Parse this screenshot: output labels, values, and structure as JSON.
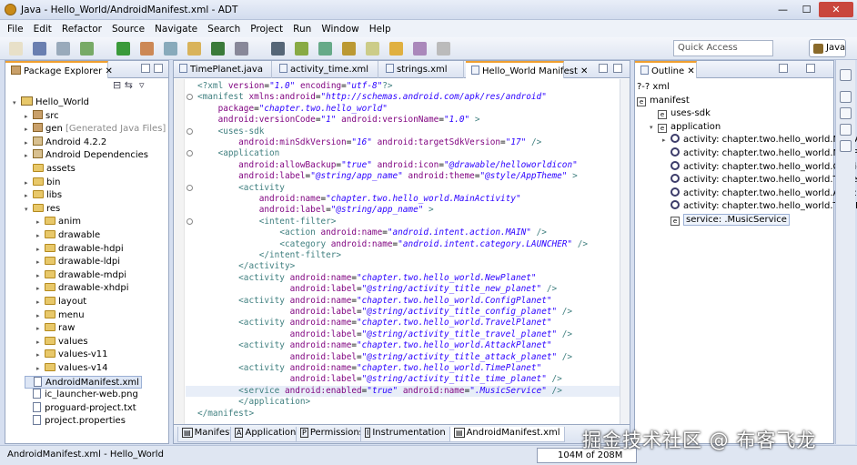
{
  "window": {
    "title": "Java - Hello_World/AndroidManifest.xml - ADT",
    "min": "—",
    "max": "☐",
    "close": "✕"
  },
  "menu": [
    "File",
    "Edit",
    "Refactor",
    "Source",
    "Navigate",
    "Search",
    "Project",
    "Run",
    "Window",
    "Help"
  ],
  "toolbar": {
    "quick_access_placeholder": "Quick Access",
    "perspective": "Java"
  },
  "package_explorer": {
    "title": "Package Explorer",
    "items": [
      {
        "label": "Hello_World",
        "extra": "",
        "icon": "project-icon",
        "depth": 0,
        "twisty": "▾"
      },
      {
        "label": "src",
        "extra": "",
        "icon": "package-folder-icon",
        "depth": 1,
        "twisty": "▸"
      },
      {
        "label": "gen",
        "extra": "[Generated Java Files]",
        "icon": "package-folder-icon",
        "depth": 1,
        "twisty": "▸"
      },
      {
        "label": "Android 4.2.2",
        "extra": "",
        "icon": "library-icon",
        "depth": 1,
        "twisty": "▸"
      },
      {
        "label": "Android Dependencies",
        "extra": "",
        "icon": "library-icon",
        "depth": 1,
        "twisty": "▸"
      },
      {
        "label": "assets",
        "extra": "",
        "icon": "folder-icon",
        "depth": 1,
        "twisty": ""
      },
      {
        "label": "bin",
        "extra": "",
        "icon": "folder-icon",
        "depth": 1,
        "twisty": "▸"
      },
      {
        "label": "libs",
        "extra": "",
        "icon": "folder-icon",
        "depth": 1,
        "twisty": "▸"
      },
      {
        "label": "res",
        "extra": "",
        "icon": "folder-icon",
        "depth": 1,
        "twisty": "▾"
      },
      {
        "label": "anim",
        "extra": "",
        "icon": "folder-icon",
        "depth": 2,
        "twisty": "▸"
      },
      {
        "label": "drawable",
        "extra": "",
        "icon": "folder-icon",
        "depth": 2,
        "twisty": "▸"
      },
      {
        "label": "drawable-hdpi",
        "extra": "",
        "icon": "folder-icon",
        "depth": 2,
        "twisty": "▸"
      },
      {
        "label": "drawable-ldpi",
        "extra": "",
        "icon": "folder-icon",
        "depth": 2,
        "twisty": "▸"
      },
      {
        "label": "drawable-mdpi",
        "extra": "",
        "icon": "folder-icon",
        "depth": 2,
        "twisty": "▸"
      },
      {
        "label": "drawable-xhdpi",
        "extra": "",
        "icon": "folder-icon",
        "depth": 2,
        "twisty": "▸"
      },
      {
        "label": "layout",
        "extra": "",
        "icon": "folder-icon",
        "depth": 2,
        "twisty": "▸"
      },
      {
        "label": "menu",
        "extra": "",
        "icon": "folder-icon",
        "depth": 2,
        "twisty": "▸"
      },
      {
        "label": "raw",
        "extra": "",
        "icon": "folder-icon",
        "depth": 2,
        "twisty": "▸"
      },
      {
        "label": "values",
        "extra": "",
        "icon": "folder-icon",
        "depth": 2,
        "twisty": "▸"
      },
      {
        "label": "values-v11",
        "extra": "",
        "icon": "folder-icon",
        "depth": 2,
        "twisty": "▸"
      },
      {
        "label": "values-v14",
        "extra": "",
        "icon": "folder-icon",
        "depth": 2,
        "twisty": "▸"
      },
      {
        "label": "AndroidManifest.xml",
        "extra": "",
        "icon": "file-icon",
        "depth": 1,
        "twisty": "",
        "selected": true
      },
      {
        "label": "ic_launcher-web.png",
        "extra": "",
        "icon": "file-icon",
        "depth": 1,
        "twisty": ""
      },
      {
        "label": "proguard-project.txt",
        "extra": "",
        "icon": "file-icon",
        "depth": 1,
        "twisty": ""
      },
      {
        "label": "project.properties",
        "extra": "",
        "icon": "file-icon",
        "depth": 1,
        "twisty": ""
      }
    ]
  },
  "editor": {
    "tabs": [
      "TimePlanet.java",
      "activity_time.xml",
      "strings.xml",
      "Hello_World Manifest"
    ],
    "active_tab": "Hello_World Manifest",
    "bottom_tabs": [
      {
        "badge": "",
        "label": "Manifest"
      },
      {
        "badge": "A",
        "label": "Application"
      },
      {
        "badge": "P",
        "label": "Permissions"
      },
      {
        "badge": "I",
        "label": "Instrumentation"
      },
      {
        "badge": "",
        "label": "AndroidManifest.xml"
      }
    ],
    "lines": [
      "<?xml version=\"1.0\" encoding=\"utf-8\"?>",
      "<manifest xmlns:android=\"http://schemas.android.com/apk/res/android\"",
      "    package=\"chapter.two.hello_world\"",
      "    android:versionCode=\"1\" android:versionName=\"1.0\" >",
      "    <uses-sdk",
      "        android:minSdkVersion=\"16\" android:targetSdkVersion=\"17\" />",
      "    <application",
      "        android:allowBackup=\"true\" android:icon=\"@drawable/helloworldicon\"",
      "        android:label=\"@string/app_name\" android:theme=\"@style/AppTheme\" >",
      "        <activity",
      "            android:name=\"chapter.two.hello_world.MainActivity\"",
      "            android:label=\"@string/app_name\" >",
      "            <intent-filter>",
      "                <action android:name=\"android.intent.action.MAIN\" />",
      "                <category android:name=\"android.intent.category.LAUNCHER\" />",
      "            </intent-filter>",
      "        </activity>",
      "        <activity android:name=\"chapter.two.hello_world.NewPlanet\"",
      "                  android:label=\"@string/activity_title_new_planet\" />",
      "        <activity android:name=\"chapter.two.hello_world.ConfigPlanet\"",
      "                  android:label=\"@string/activity_title_config_planet\" />",
      "        <activity android:name=\"chapter.two.hello_world.TravelPlanet\"",
      "                  android:label=\"@string/activity_title_travel_planet\" />",
      "        <activity android:name=\"chapter.two.hello_world.AttackPlanet\"",
      "                  android:label=\"@string/activity_title_attack_planet\" />",
      "        <activity android:name=\"chapter.two.hello_world.TimePlanet\"",
      "                  android:label=\"@string/activity_title_time_planet\" />",
      "        <service android:enabled=\"true\" android:name=\".MusicService\" />",
      "        </application>",
      "</manifest>"
    ]
  },
  "outline": {
    "title": "Outline",
    "items": [
      {
        "label": "?-? xml",
        "icon": "",
        "depth": 0
      },
      {
        "label": "manifest",
        "icon": "e",
        "depth": 0
      },
      {
        "label": "uses-sdk",
        "icon": "e",
        "depth": 1
      },
      {
        "label": "application",
        "icon": "e",
        "depth": 1,
        "twisty": "▾"
      },
      {
        "label": "activity: chapter.two.hello_world.MainA",
        "icon": "c",
        "depth": 2,
        "twisty": "▸"
      },
      {
        "label": "activity: chapter.two.hello_world.NewPl",
        "icon": "c",
        "depth": 2
      },
      {
        "label": "activity: chapter.two.hello_world.Config",
        "icon": "c",
        "depth": 2
      },
      {
        "label": "activity: chapter.two.hello_world.TravelP",
        "icon": "c",
        "depth": 2
      },
      {
        "label": "activity: chapter.two.hello_world.AttackI",
        "icon": "c",
        "depth": 2
      },
      {
        "label": "activity: chapter.two.hello_world.TimePl",
        "icon": "c",
        "depth": 2
      },
      {
        "label": "service: .MusicService",
        "icon": "e",
        "depth": 2,
        "selected": true
      }
    ]
  },
  "status": {
    "text": "AndroidManifest.xml - Hello_World",
    "heap": "104M of 208M"
  },
  "watermark": "掘金技术社区 @ 布客飞龙"
}
